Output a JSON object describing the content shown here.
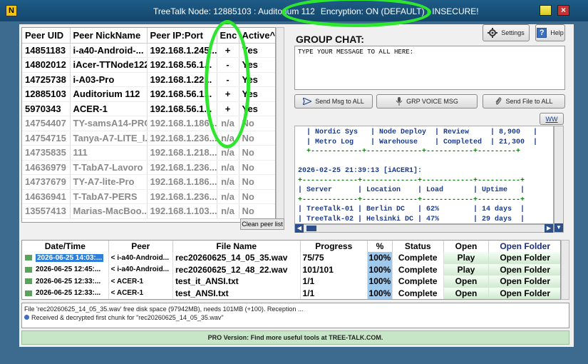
{
  "window": {
    "title": "TreeTalk Node: 12885103 : Auditorium 112",
    "encryption": "Encryption: ON (DEFAULT) - INSECURE!",
    "app_icon": "N"
  },
  "peers": {
    "headers": [
      "Peer UID",
      "Peer NickName",
      "Peer IP:Port",
      "Enc",
      "Active^"
    ],
    "rows": [
      {
        "uid": "14851183",
        "nick": "i-a40-Android-...",
        "ip": "192.168.1.245...",
        "enc": "+",
        "active": "Yes",
        "active_row": true
      },
      {
        "uid": "14802012",
        "nick": "iAcer-TTNode122",
        "ip": "192.168.56.1...",
        "enc": "-",
        "active": "Yes",
        "active_row": true
      },
      {
        "uid": "14725738",
        "nick": "i-A03-Pro",
        "ip": "192.168.1.22...",
        "enc": "-",
        "active": "Yes",
        "active_row": true
      },
      {
        "uid": "12885103",
        "nick": "Auditorium 112",
        "ip": "192.168.56.1...",
        "enc": "+",
        "active": "Yes",
        "active_row": true
      },
      {
        "uid": "5970343",
        "nick": "ACER-1",
        "ip": "192.168.56.1...",
        "enc": "+",
        "active": "Yes",
        "active_row": true
      },
      {
        "uid": "14754407",
        "nick": "TY-samsA14-PRO",
        "ip": "192.168.1.186...",
        "enc": "n/a",
        "active": "No",
        "active_row": false
      },
      {
        "uid": "14754715",
        "nick": "Tanya-A7-LITE_I...",
        "ip": "192.168.1.236...",
        "enc": "n/a",
        "active": "No",
        "active_row": false
      },
      {
        "uid": "14735835",
        "nick": "111",
        "ip": "192.168.1.218...",
        "enc": "n/a",
        "active": "No",
        "active_row": false
      },
      {
        "uid": "14636979",
        "nick": "T-TabA7-Lavoro",
        "ip": "192.168.1.236...",
        "enc": "n/a",
        "active": "No",
        "active_row": false
      },
      {
        "uid": "14737679",
        "nick": "TY-A7-lite-Pro",
        "ip": "192.168.1.186...",
        "enc": "n/a",
        "active": "No",
        "active_row": false
      },
      {
        "uid": "14636941",
        "nick": "T-TabA7-PERS",
        "ip": "192.168.1.236...",
        "enc": "n/a",
        "active": "No",
        "active_row": false
      },
      {
        "uid": "13557413",
        "nick": "Marias-MacBoo...",
        "ip": "192.168.1.103...",
        "enc": "n/a",
        "active": "No",
        "active_row": false
      }
    ],
    "clean_button": "Clean peer list"
  },
  "chat": {
    "title": "GROUP CHAT:",
    "settings_label": "Settings",
    "help_label": "Help",
    "input_placeholder": "TYPE YOUR MESSAGE TO ALL HERE:",
    "send_msg_label": "Send Msg to ALL",
    "voice_label": "GRP VOICE MSG",
    "send_file_label": "Send File to ALL",
    "ww_label": "WW",
    "log_lines": [
      {
        "text": "  | Nordic Sys   | Node Deploy  | Review     | 8,900   |",
        "kind": "b"
      },
      {
        "text": "  | Metro Log    | Warehouse    | Completed  | 21,300  |",
        "kind": "b"
      },
      {
        "text": "  +------------+-------------+-----------+---------+",
        "kind": "g"
      },
      {
        "text": "",
        "kind": "b"
      },
      {
        "text": "2026-02-25 21:39:13 [iACER1]:",
        "kind": "b"
      },
      {
        "text": "+-------------+-------------+------------+----------+",
        "kind": "g"
      },
      {
        "text": "| Server      | Location    | Load       | Uptime   |",
        "kind": "b"
      },
      {
        "text": "+-------------+-------------+------------+----------+",
        "kind": "g"
      },
      {
        "text": "| TreeTalk-01 | Berlin DC   | 62%        | 14 days  |",
        "kind": "b"
      },
      {
        "text": "| TreeTalk-02 | Helsinki DC | 47%        | 29 days  |",
        "kind": "b"
      }
    ]
  },
  "transfers": {
    "headers": [
      "Date/Time",
      "Peer",
      "File Name",
      "Progress",
      "%",
      "Status",
      "Open",
      "Open Folder"
    ],
    "rows": [
      {
        "datetime": "2026-06-25 14:03:...",
        "peer": "< i-a40-Android...",
        "file": "rec20260625_14_05_35.wav",
        "progress": "75/75",
        "pct": "100%",
        "status": "Complete",
        "open": "Play",
        "folder": "Open Folder",
        "selected": true
      },
      {
        "datetime": "2026-06-25 12:45:...",
        "peer": "< i-a40-Android...",
        "file": "rec20260625_12_48_22.wav",
        "progress": "101/101",
        "pct": "100%",
        "status": "Complete",
        "open": "Play",
        "folder": "Open Folder",
        "selected": false
      },
      {
        "datetime": "2026-06-25 12:33:...",
        "peer": "< ACER-1",
        "file": "test_it_ANSI.txt",
        "progress": "1/1",
        "pct": "100%",
        "status": "Complete",
        "open": "Open",
        "folder": "Open Folder",
        "selected": false
      },
      {
        "datetime": "2026-06-25 12:33:...",
        "peer": "< ACER-1",
        "file": "test_ANSI.txt",
        "progress": "1/1",
        "pct": "100%",
        "status": "Complete",
        "open": "Open",
        "folder": "Open Folder",
        "selected": false
      }
    ]
  },
  "status": {
    "line1": "File 'rec20260625_14_05_35.wav' free disk space (97942MB), needs 101MB (+100). Reception ...",
    "line2": "Received & decrypted first chunk for \"rec20260625_14_05_35.wav\""
  },
  "footer": {
    "pro_text": "PRO Version: Find more useful tools at TREE-TALK.COM."
  },
  "colors": {
    "annotation": "#2ee62e",
    "titlebar": "#1e5c87",
    "selection": "#2e7fd9"
  }
}
